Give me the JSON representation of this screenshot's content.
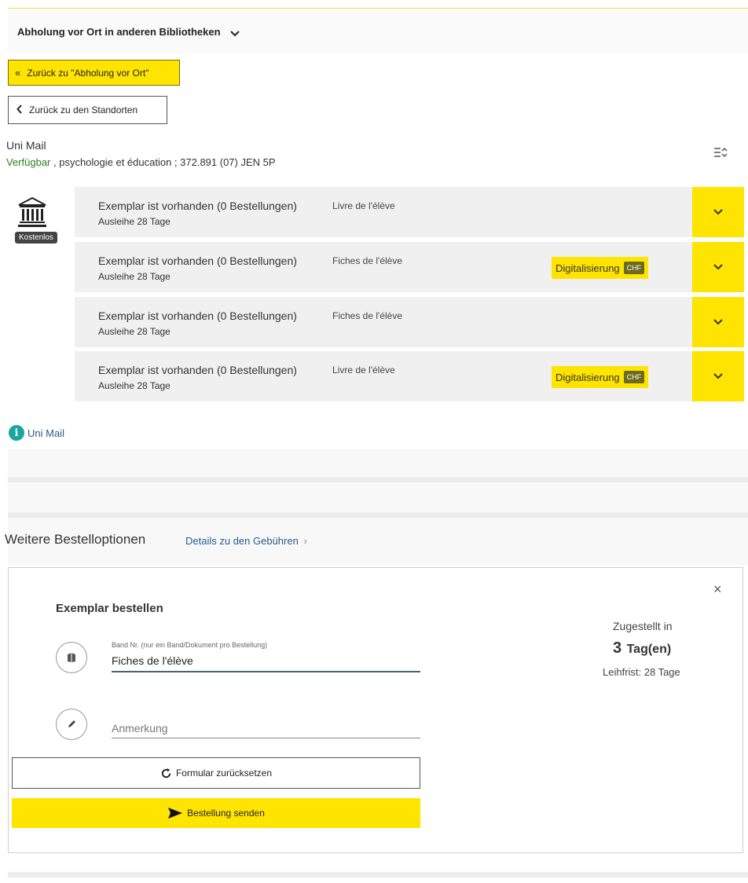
{
  "header": {
    "title": "Abholung vor Ort in anderen Bibliotheken"
  },
  "nav": {
    "back_pickup": "Zurück zu \"Abholung vor Ort\"",
    "back_locations": "Zurück zu den Standorten"
  },
  "location": {
    "name": "Uni Mail",
    "availability": "Verfügbar",
    "details": " , psychologie et éducation ; 372.891 (07) JEN 5P",
    "badge": "Kostenlos",
    "info_link": "Uni Mail"
  },
  "items": [
    {
      "status": "Exemplar ist vorhanden (0 Bestellungen)",
      "volume": "Livre de l'élève",
      "loan": "Ausleihe 28 Tage",
      "digitize": "",
      "currency": ""
    },
    {
      "status": "Exemplar ist vorhanden (0 Bestellungen)",
      "volume": "Fiches de l'élève",
      "loan": "Ausleihe 28 Tage",
      "digitize": "Digitalisierung",
      "currency": "CHF"
    },
    {
      "status": "Exemplar ist vorhanden (0 Bestellungen)",
      "volume": "Fiches de l'élève",
      "loan": "Ausleihe 28 Tage",
      "digitize": "",
      "currency": ""
    },
    {
      "status": "Exemplar ist vorhanden (0 Bestellungen)",
      "volume": "Livre de l'élève",
      "loan": "Ausleihe 28 Tage",
      "digitize": "Digitalisierung",
      "currency": "CHF"
    }
  ],
  "more_options": {
    "title": "Weitere Bestelloptionen",
    "details_link": "Details zu den Gebühren"
  },
  "order": {
    "title": "Exemplar bestellen",
    "volume_label": "Band Nr. (nur ein Band/Dokument pro Bestellung)",
    "volume_value": "Fiches de l'élève",
    "note_placeholder": "Anmerkung",
    "delivered_label": "Zugestellt in",
    "delivered_days": "3",
    "delivered_unit": "Tag(en)",
    "loan_period": "Leihfrist: 28 Tage",
    "reset_label": "Formular zurücksetzen",
    "send_label": "Bestellung senden"
  },
  "colors": {
    "accent": "#ffe400",
    "available": "#2e7d1f",
    "link": "#2a5b8a",
    "info": "#1aa6a0"
  }
}
